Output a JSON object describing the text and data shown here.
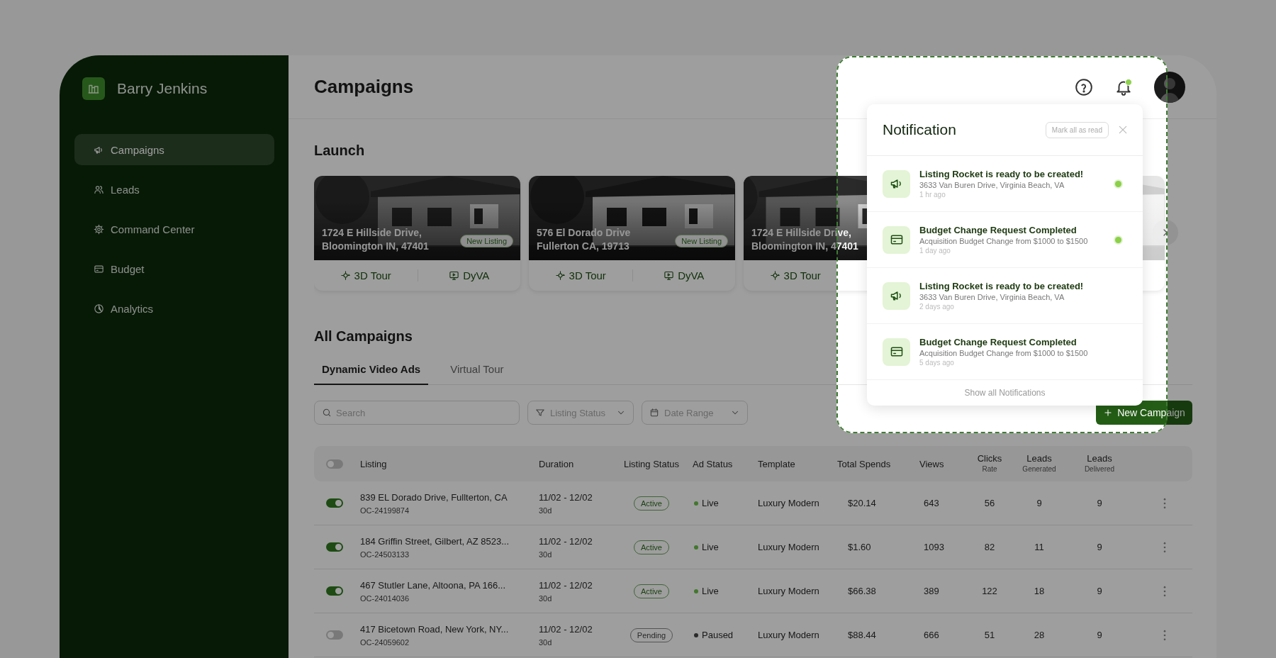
{
  "sidebar": {
    "account_name": "Barry Jenkins",
    "items": [
      {
        "label": "Campaigns",
        "selected": true
      },
      {
        "label": "Leads",
        "selected": false
      },
      {
        "label": "Command Center",
        "selected": false
      },
      {
        "label": "Budget",
        "selected": false
      },
      {
        "label": "Analytics",
        "selected": false
      }
    ]
  },
  "header": {
    "title": "Campaigns",
    "notifications_unread": true
  },
  "launch": {
    "heading": "Launch",
    "cards": [
      {
        "address_line1": "1724 E Hillside Drive,",
        "address_line2": "Bloomington IN, 47401",
        "badge": "New Listing",
        "actions": [
          "3D Tour",
          "DyVA"
        ]
      },
      {
        "address_line1": "576 El Dorado Drive",
        "address_line2": "Fullerton CA, 19713",
        "badge": "New Listing",
        "actions": [
          "3D Tour",
          "DyVA"
        ]
      },
      {
        "address_line1": "1724 E Hillside Drive,",
        "address_line2": "Bloomington IN, 47401",
        "actions": [
          "3D Tour"
        ]
      },
      {
        "kind": "picture"
      }
    ]
  },
  "campaigns": {
    "heading": "All Campaigns",
    "tabs": [
      {
        "label": "Dynamic Video Ads",
        "selected": true
      },
      {
        "label": "Virtual Tour",
        "selected": false
      }
    ],
    "filters": {
      "search_placeholder": "Search",
      "listing_status_placeholder": "Listing Status",
      "date_range_placeholder": "Date Range"
    },
    "new_button": "New Campaign",
    "table": {
      "select_all_on": false,
      "columns": [
        {
          "label": "Listing"
        },
        {
          "label": "Duration"
        },
        {
          "label": "Listing Status"
        },
        {
          "label": "Ad Status"
        },
        {
          "label": "Template"
        },
        {
          "label": "Total Spends"
        },
        {
          "label": "Views"
        },
        {
          "label": "Clicks",
          "sublabel": "Rate"
        },
        {
          "label": "Leads",
          "sublabel": "Generated"
        },
        {
          "label": "Leads",
          "sublabel": "Delivered"
        }
      ],
      "rows": [
        {
          "on": true,
          "listing": "839 EL Dorado Drive, Fullterton, CA",
          "id": "OC-24199874",
          "dates": "11/02 - 12/02",
          "days": "30d",
          "listing_status": {
            "label": "Active",
            "kind": "active"
          },
          "ad_status": {
            "label": "Live",
            "kind": "live"
          },
          "template": "Luxury Modern",
          "total_spends": "$20.14",
          "views": "643",
          "clicks_rate": "56",
          "leads_generated": "9",
          "leads_delivered": "9"
        },
        {
          "on": true,
          "listing": "184 Griffin Street, Gilbert, AZ 8523...",
          "id": "OC-24503133",
          "dates": "11/02 - 12/02",
          "days": "30d",
          "listing_status": {
            "label": "Active",
            "kind": "active"
          },
          "ad_status": {
            "label": "Live",
            "kind": "live"
          },
          "template": "Luxury Modern",
          "total_spends": "$1.60",
          "views": "1093",
          "clicks_rate": "82",
          "leads_generated": "11",
          "leads_delivered": "9"
        },
        {
          "on": true,
          "listing": "467 Stutler Lane, Altoona, PA 166...",
          "id": "OC-24014036",
          "dates": "11/02 - 12/02",
          "days": "30d",
          "listing_status": {
            "label": "Active",
            "kind": "active"
          },
          "ad_status": {
            "label": "Live",
            "kind": "live"
          },
          "template": "Luxury Modern",
          "total_spends": "$66.38",
          "views": "389",
          "clicks_rate": "122",
          "leads_generated": "18",
          "leads_delivered": "9"
        },
        {
          "on": false,
          "listing": "417 Bicetown Road, New York, NY...",
          "id": "OC-24059602",
          "dates": "11/02 - 12/02",
          "days": "30d",
          "listing_status": {
            "label": "Pending",
            "kind": "pending"
          },
          "ad_status": {
            "label": "Paused",
            "kind": "paused"
          },
          "template": "Luxury Modern",
          "total_spends": "$88.44",
          "views": "666",
          "clicks_rate": "51",
          "leads_generated": "28",
          "leads_delivered": "9"
        }
      ]
    }
  },
  "notifications": {
    "title": "Notification",
    "mark_all": "Mark all as read",
    "items": [
      {
        "kind": "listing",
        "title": "Listing Rocket is ready to be created!",
        "detail": "3633 Van Buren Drive, Virginia Beach, VA",
        "time": "1 hr ago",
        "unread": true
      },
      {
        "kind": "budget",
        "title": "Budget Change Request Completed",
        "detail": "Acquisition Budget Change from $1000 to $1500",
        "time": "1 day ago",
        "unread": true
      },
      {
        "kind": "listing",
        "title": "Listing Rocket is ready to be created!",
        "detail": "3633 Van Buren Drive, Virginia Beach, VA",
        "time": "2 days ago",
        "unread": false
      },
      {
        "kind": "budget",
        "title": "Budget Change Request Completed",
        "detail": "Acquisition Budget Change from $1000 to $1500",
        "time": "5 days ago",
        "unread": false
      }
    ],
    "footer": "Show all Notifications"
  }
}
